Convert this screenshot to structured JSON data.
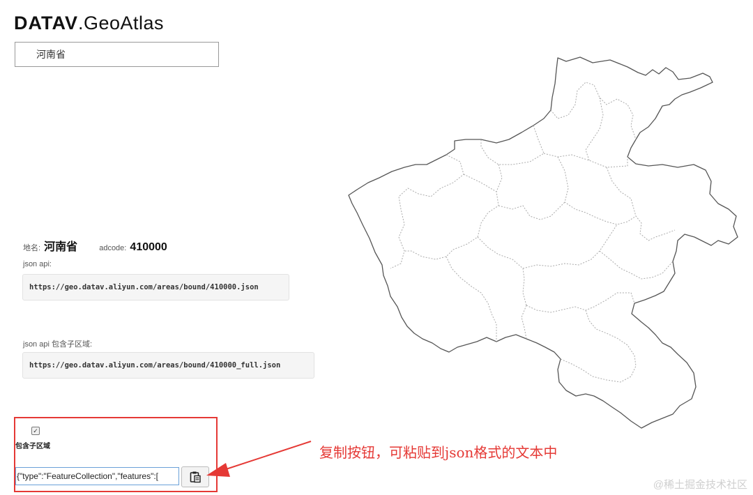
{
  "logo": {
    "brand": "DATAV",
    "product": ".GeoAtlas"
  },
  "search": {
    "value": "河南省"
  },
  "info": {
    "name_label": "地名:",
    "name_value": "河南省",
    "adcode_label": "adcode:",
    "adcode_value": "410000"
  },
  "api": {
    "label": "json api:",
    "url": "https://geo.datav.aliyun.com/areas/bound/410000.json"
  },
  "api_full": {
    "label": "json api 包含子区域:",
    "url": "https://geo.datav.aliyun.com/areas/bound/410000_full.json"
  },
  "include_sub": {
    "label": "包含子区域",
    "checked": true
  },
  "json_field": {
    "value": "{\"type\":\"FeatureCollection\",\"features\":["
  },
  "copy_button": {
    "icon": "clipboard-icon"
  },
  "annotation": {
    "text": "复制按钮，可粘贴到json格式的文本中",
    "color": "#e53935"
  },
  "watermark": {
    "text": "@稀土掘金技术社区"
  },
  "map": {
    "region": "河南省",
    "outline_color": "#555555",
    "inner_border_color": "#aaaaaa"
  }
}
